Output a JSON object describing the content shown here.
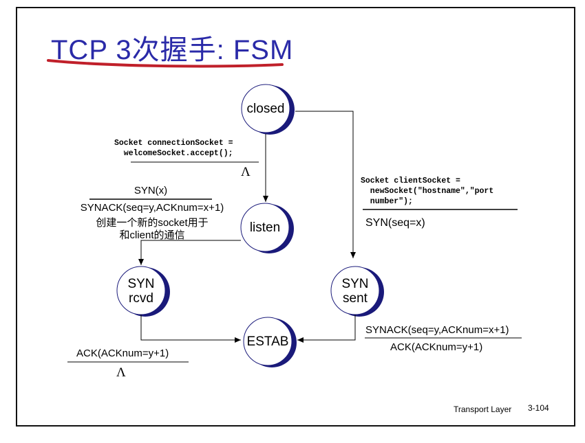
{
  "title": "TCP 3次握手: FSM",
  "states": {
    "closed": "closed",
    "listen": "listen",
    "syn_rcvd": "SYN\nrcvd",
    "syn_sent": "SYN\nsent",
    "estab": "ESTAB"
  },
  "transitions": {
    "closed_to_listen": {
      "event": "Socket connectionSocket =\n  welcomeSocket.accept();",
      "action": "Λ"
    },
    "listen_to_synrcvd": {
      "event": "SYN(x)",
      "action_line1": "SYNACK(seq=y,ACKnum=x+1)",
      "action_line2": "创建一个新的socket用于",
      "action_line3": "和client的通信"
    },
    "closed_to_synsent": {
      "event": "Socket clientSocket =\n  newSocket(\"hostname\",\"port\n  number\");",
      "action": "SYN(seq=x)"
    },
    "synsent_to_estab": {
      "event": "SYNACK(seq=y,ACKnum=x+1)",
      "action": "ACK(ACKnum=y+1)"
    },
    "synrcvd_to_estab": {
      "event": "ACK(ACKnum=y+1)",
      "action": "Λ"
    }
  },
  "footer": {
    "label": "Transport Layer",
    "page": "3-104"
  },
  "colors": {
    "title": "#2a2aa8",
    "underline": "#c0202a",
    "state_shadow": "#1a1a7a",
    "line": "#000000"
  }
}
